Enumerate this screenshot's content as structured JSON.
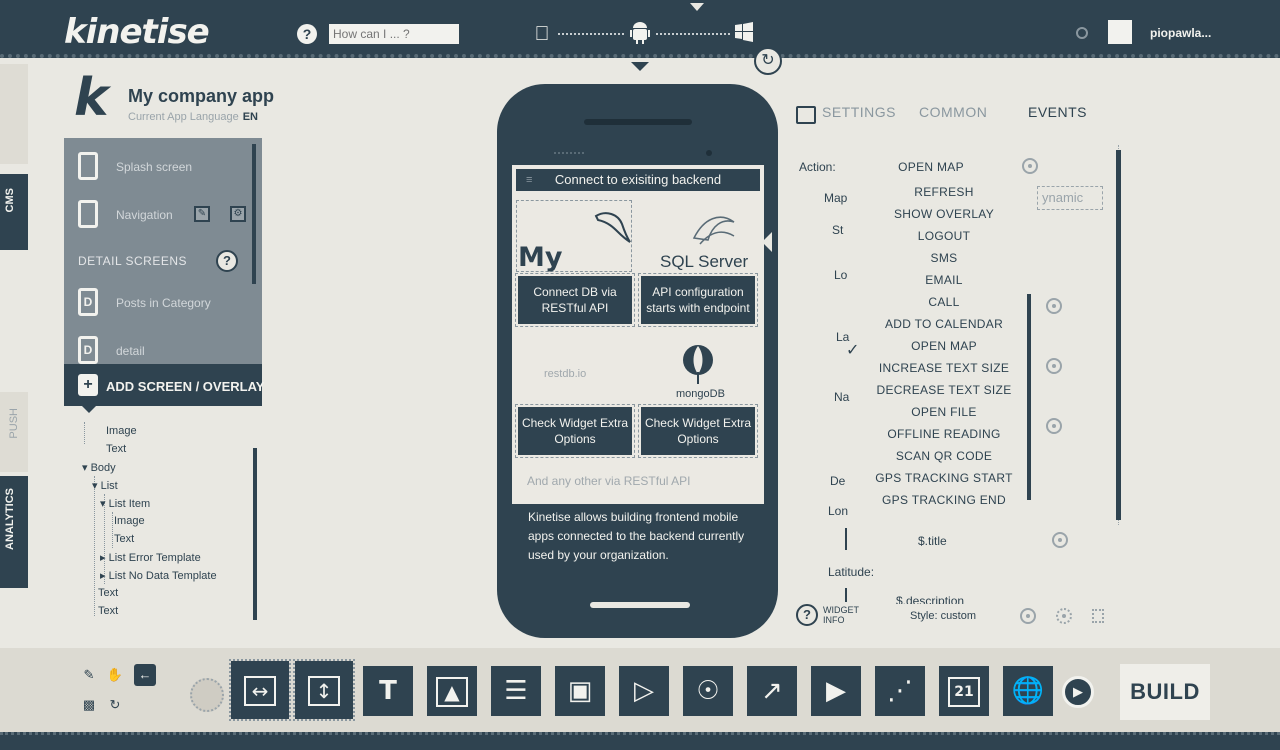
{
  "topbar": {
    "logo": "kinetise",
    "help": "?",
    "search_placeholder": "How can I ... ?",
    "platform_icons": [
      "apple-icon",
      "android-icon",
      "windows-icon"
    ],
    "user": "piopawla..."
  },
  "sidetabs": {
    "cms": "CMS",
    "push": "PUSH",
    "analytics": "ANALYTICS"
  },
  "app": {
    "title": "My company app",
    "lang_label": "Current App Language",
    "lang": "EN"
  },
  "screens": {
    "items": [
      {
        "label": "Splash screen"
      },
      {
        "label": "Navigation"
      }
    ],
    "detail_heading": "DETAIL SCREENS",
    "detail_items": [
      {
        "label": "Posts in Category",
        "letter": "D"
      },
      {
        "label": "detail",
        "letter": "D"
      }
    ],
    "add_label": "ADD SCREEN / OVERLAY"
  },
  "tree": [
    {
      "label": "Image"
    },
    {
      "label": "Text"
    },
    {
      "label": "Body"
    },
    {
      "label": "List"
    },
    {
      "label": "List Item"
    },
    {
      "label": "Image"
    },
    {
      "label": "Text"
    },
    {
      "label": "List Error Template"
    },
    {
      "label": "List No Data Template"
    },
    {
      "label": "Text"
    },
    {
      "label": "Text"
    }
  ],
  "phone": {
    "header": "Connect to exisiting backend",
    "mysql_logo": "My",
    "sqlserver_logo": "SQL Server",
    "btn1": "Connect DB via RESTful API",
    "btn2": "API configuration starts with endpoint",
    "restdb_logo": "restdb.io",
    "mongodb_logo": "mongoDB",
    "btn3": "Check Widget Extra Options",
    "btn4": "Check Widget Extra Options",
    "any_other": "And any other via RESTful API",
    "footer": "Kinetise allows building frontend mobile apps connected to the backend currently used by your organization."
  },
  "right": {
    "tabs": [
      "SETTINGS",
      "COMMON",
      "EVENTS"
    ],
    "action_label": "Action:",
    "selected_action": "OPEN MAP",
    "partial_labels": {
      "map": "Map",
      "st": "St",
      "lo": "Lo",
      "la": "La",
      "na": "Na",
      "de": "De",
      "lon": "Lon"
    },
    "dynamic": "ynamic",
    "dropdown": [
      "REFRESH",
      "SHOW OVERLAY",
      "LOGOUT",
      "SMS",
      "EMAIL",
      "CALL",
      "ADD TO CALENDAR",
      "OPEN MAP",
      "INCREASE TEXT SIZE",
      "DECREASE TEXT SIZE",
      "OPEN FILE",
      "OFFLINE READING",
      "SCAN QR CODE",
      "GPS TRACKING START",
      "GPS TRACKING END"
    ],
    "title_value": "$.title",
    "latitude_label": "Latitude:",
    "desc_value": "$.description",
    "widget_info": "WIDGET INFO",
    "style": "Style: custom"
  },
  "toolbar": {
    "tools": [
      "horizontal-container-icon",
      "vertical-container-icon",
      "text-icon",
      "image-icon",
      "list-icon",
      "gallery-icon",
      "video-list-icon",
      "map-icon",
      "chart-icon",
      "video-icon",
      "share-icon",
      "calendar-icon",
      "web-browser-icon"
    ],
    "calendar_day": "21",
    "text_tool": "T",
    "build": "BUILD"
  }
}
